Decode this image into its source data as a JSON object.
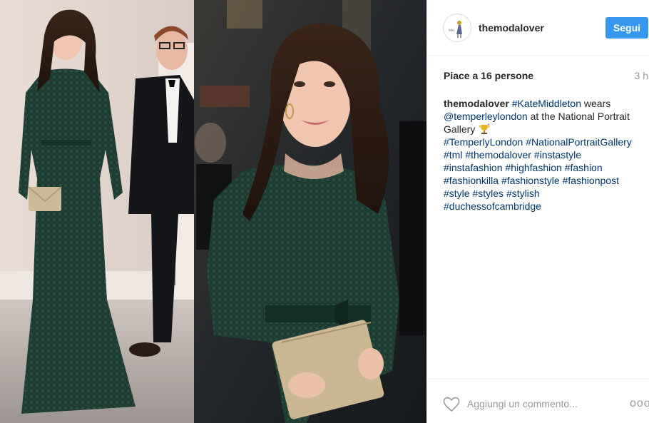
{
  "post": {
    "username": "themodalover",
    "follow_label": "Segui",
    "likes_text": "Piace a 16 persone",
    "time_ago": "3 h",
    "caption": {
      "user": "themodalover",
      "tag_kate": "#KateMiddleton",
      "text_wears": " wears ",
      "mention": "@temperleylondon",
      "text_at": " at the National Portrait Gallery ",
      "emoji": "trophy-sparkle-emoji",
      "hashtags_line1": [
        "#TemperlyLondon",
        "#NationalPortraitGallery"
      ],
      "hashtags_line2": [
        "#tml",
        "#themodalover",
        "#instastyle"
      ],
      "hashtags_line3": [
        "#instafashion",
        "#highfashion",
        "#fashion"
      ],
      "hashtags_line4": [
        "#fashionkilla",
        "#fashionstyle",
        "#fashionpost"
      ],
      "hashtags_line5": [
        "#style",
        "#styles",
        "#stylish"
      ],
      "hashtags_line6": [
        "#duchessofcambridge"
      ]
    },
    "comment_placeholder": "Aggiungi un commento...",
    "more_label": "ooo",
    "avatar_icon": "fashion-figure-logo",
    "like_icon": "heart-outline-icon"
  },
  "colors": {
    "follow_button": "#3897f0",
    "link": "#003569",
    "muted": "#999999",
    "text": "#262626",
    "dress": "#1f3d33"
  }
}
